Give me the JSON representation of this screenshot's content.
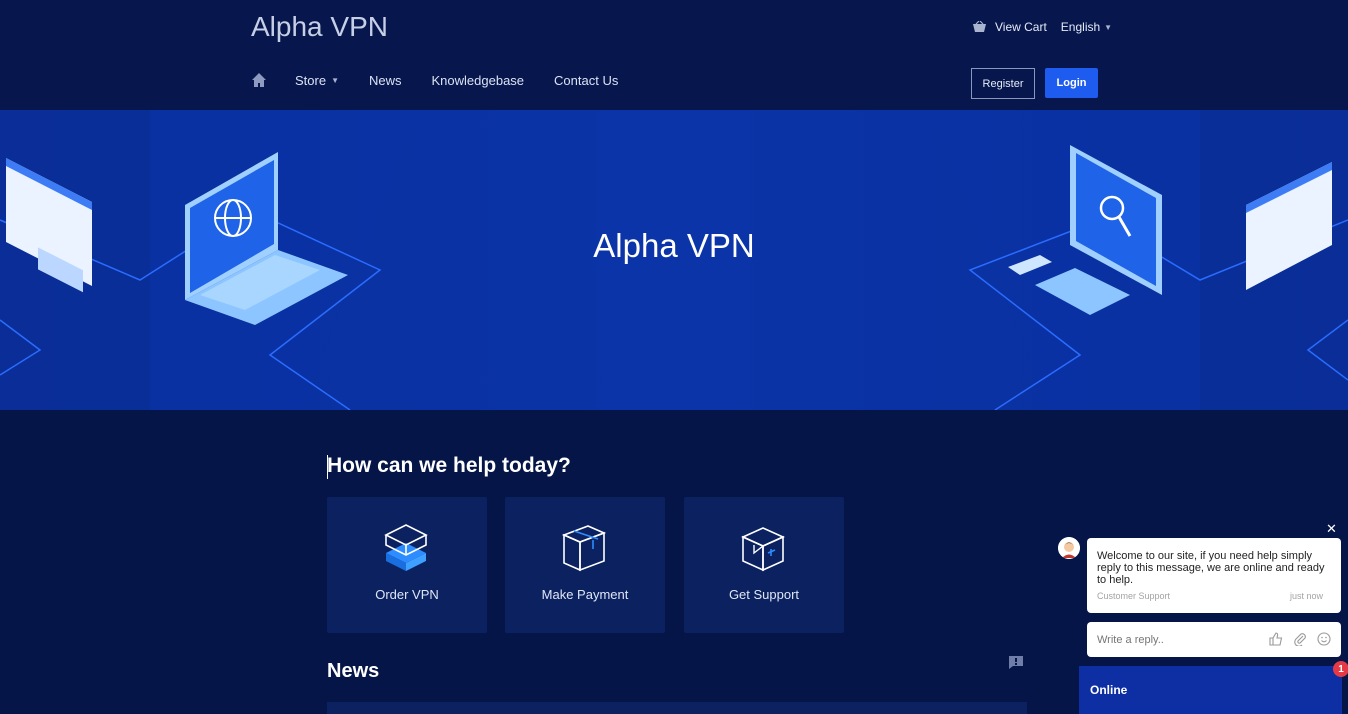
{
  "header": {
    "brand": "Alpha VPN",
    "view_cart": "View Cart",
    "language": "English",
    "nav": {
      "store": "Store",
      "news": "News",
      "knowledgebase": "Knowledgebase",
      "contact": "Contact Us"
    },
    "register": "Register",
    "login": "Login"
  },
  "hero": {
    "title": "Alpha VPN"
  },
  "main": {
    "heading": "How can we help today?",
    "cards": [
      {
        "label": "Order VPN",
        "icon": "box-stack-icon"
      },
      {
        "label": "Make Payment",
        "icon": "package-icon"
      },
      {
        "label": "Get Support",
        "icon": "open-box-icon"
      }
    ],
    "news_heading": "News"
  },
  "chat": {
    "message": "Welcome to our site, if you need help simply reply to this message, we are online and ready to help.",
    "sender": "Customer Support",
    "time": "just now",
    "reply_placeholder": "Write a reply..",
    "status": "Online",
    "badge_count": "1"
  },
  "colors": {
    "background": "#051547",
    "accent": "#1e5cf0",
    "hero": "#0a34a8"
  }
}
